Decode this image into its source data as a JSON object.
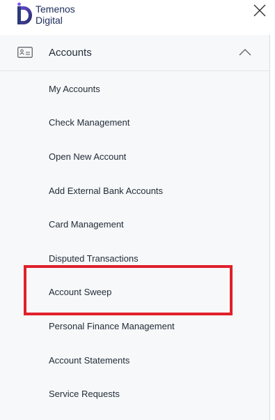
{
  "logo": {
    "line1": "Temenos",
    "line2": "Digital"
  },
  "icons": {
    "close": "close-icon",
    "accounts": "account-card-icon",
    "collapse": "chevron-up-icon"
  },
  "section": {
    "label": "Accounts"
  },
  "menu": {
    "items": [
      "My Accounts",
      "Check Management",
      "Open New Account",
      "Add External Bank Accounts",
      "Card Management",
      "Disputed Transactions",
      "Account Sweep",
      "Personal Finance Management",
      "Account Statements",
      "Service Requests"
    ]
  },
  "colors": {
    "brand": "#1c2b5a",
    "highlight": "#e0202a",
    "panel_bg": "#f7f8f9"
  }
}
